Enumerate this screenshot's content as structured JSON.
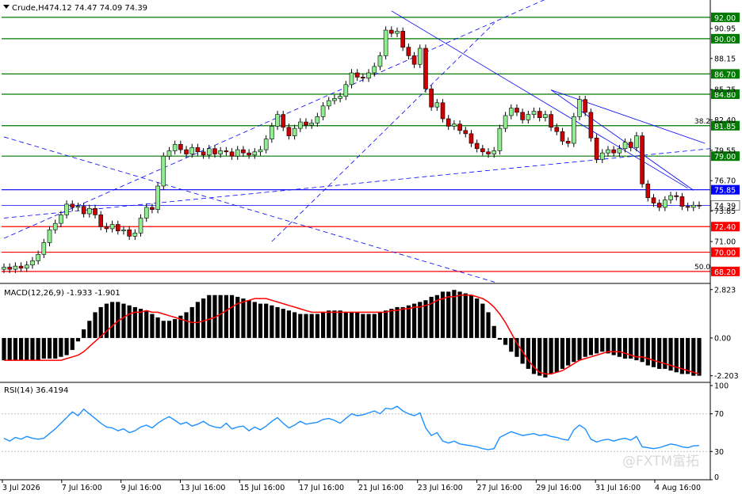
{
  "header": {
    "symbol": "Crude,H4",
    "ohlc": "74.12 74.47 74.09 74.39",
    "macd": "MACD(12,26,9) -1.933 -1.901",
    "rsi": "RSI(14) 36.4194"
  },
  "watermark": "@FXTM富拓",
  "colors": {
    "green_level": "#007a00",
    "red_level": "#ff0000",
    "blue_level": "#0000ff",
    "bull": "#90ee90",
    "bear": "#cc0000",
    "macd_signal": "#ff0000",
    "rsi": "#1e90ff",
    "trend": "#0000ff"
  },
  "chart_data": {
    "type": "candlestick",
    "x_tick_labels": [
      "3 Jul 2026",
      "7 Jul 16:00",
      "9 Jul 16:00",
      "13 Jul 16:00",
      "15 Jul 16:00",
      "17 Jul 16:00",
      "21 Jul 16:00",
      "23 Jul 16:00",
      "27 Jul 16:00",
      "29 Jul 16:00",
      "31 Jul 16:00",
      "4 Aug 16:00"
    ],
    "price_axis": {
      "ylim": [
        67.3,
        93.4
      ],
      "ticks": [
        "90.95",
        "88.15",
        "85.25",
        "82.40",
        "79.55",
        "76.70",
        "73.85",
        "71.00"
      ]
    },
    "levels": [
      {
        "value": 92.0,
        "label": "92.00",
        "kind": "green"
      },
      {
        "value": 90.0,
        "label": "90.00",
        "kind": "green"
      },
      {
        "value": 86.7,
        "label": "86.70",
        "kind": "green"
      },
      {
        "value": 84.8,
        "label": "84.80",
        "kind": "green"
      },
      {
        "value": 81.85,
        "label": "81.85",
        "kind": "green"
      },
      {
        "value": 79.0,
        "label": "79.00",
        "kind": "green"
      },
      {
        "value": 75.85,
        "label": "75.85",
        "kind": "blue"
      },
      {
        "value": 74.39,
        "label": "74.39",
        "kind": "current"
      },
      {
        "value": 72.4,
        "label": "72.40",
        "kind": "red"
      },
      {
        "value": 70.0,
        "label": "70.00",
        "kind": "red"
      },
      {
        "value": 68.2,
        "label": "68.20",
        "kind": "red"
      }
    ],
    "fib_labels": [
      {
        "value": 81.85,
        "text": "38.2"
      },
      {
        "value": 68.2,
        "text": "50.0"
      }
    ],
    "close_series": [
      68.6,
      68.4,
      68.7,
      68.5,
      68.8,
      69.2,
      69.8,
      70.9,
      72.1,
      72.7,
      73.5,
      74.5,
      74.2,
      74.3,
      73.6,
      74.1,
      73.5,
      72.4,
      72.2,
      72.6,
      72.0,
      72.1,
      71.5,
      71.8,
      73.2,
      74.2,
      74.0,
      76.2,
      79.0,
      79.5,
      80.1,
      79.6,
      79.2,
      79.8,
      79.4,
      79.1,
      79.7,
      79.2,
      79.5,
      79.4,
      79.0,
      79.6,
      79.3,
      79.1,
      79.4,
      79.6,
      80.6,
      81.8,
      82.9,
      81.7,
      80.9,
      81.6,
      82.2,
      81.9,
      82.1,
      82.7,
      83.7,
      84.2,
      84.4,
      84.6,
      85.7,
      86.8,
      86.4,
      86.3,
      86.8,
      87.4,
      88.4,
      90.8,
      90.5,
      90.7,
      89.2,
      88.4,
      87.6,
      89.1,
      85.3,
      83.6,
      84.0,
      82.5,
      81.8,
      82.0,
      81.4,
      81.1,
      80.2,
      79.7,
      79.4,
      79.2,
      79.5,
      81.6,
      82.8,
      83.5,
      83.1,
      82.4,
      82.9,
      83.2,
      82.6,
      82.9,
      81.7,
      81.3,
      80.4,
      80.2,
      82.7,
      84.3,
      83.1,
      80.7,
      78.7,
      79.3,
      79.6,
      79.3,
      79.7,
      80.3,
      79.8,
      80.9,
      76.4,
      75.1,
      74.6,
      74.2,
      74.9,
      75.3,
      75.2,
      74.3,
      74.2,
      74.4,
      74.39
    ],
    "macd": {
      "ylim": [
        -2.45,
        2.95
      ],
      "ticks": [
        "2.823",
        "0.00",
        "-2.203"
      ],
      "histogram": [
        -1.3,
        -1.3,
        -1.3,
        -1.3,
        -1.3,
        -1.3,
        -1.3,
        -1.2,
        -1.2,
        -1.2,
        -1.1,
        -1.0,
        -0.7,
        -0.2,
        0.5,
        1.0,
        1.5,
        1.8,
        2.0,
        2.1,
        2.1,
        2.0,
        1.9,
        1.8,
        1.7,
        1.6,
        1.4,
        1.2,
        1.0,
        1.0,
        1.1,
        1.3,
        1.5,
        1.8,
        2.1,
        2.3,
        2.5,
        2.5,
        2.5,
        2.5,
        2.5,
        2.4,
        2.3,
        2.2,
        2.1,
        2.0,
        2.0,
        1.9,
        1.8,
        1.7,
        1.6,
        1.5,
        1.4,
        1.4,
        1.4,
        1.4,
        1.5,
        1.6,
        1.6,
        1.6,
        1.5,
        1.5,
        1.5,
        1.4,
        1.4,
        1.4,
        1.5,
        1.6,
        1.7,
        1.8,
        1.8,
        1.9,
        2.0,
        2.1,
        2.2,
        2.4,
        2.5,
        2.7,
        2.7,
        2.8,
        2.7,
        2.6,
        2.5,
        2.3,
        2.0,
        1.5,
        0.7,
        -0.1,
        -0.4,
        -0.8,
        -1.1,
        -1.5,
        -1.8,
        -2.1,
        -2.2,
        -2.3,
        -2.1,
        -2.0,
        -1.8,
        -1.6,
        -1.4,
        -1.3,
        -1.1,
        -1.0,
        -0.9,
        -0.8,
        -0.9,
        -1.0,
        -1.1,
        -1.2,
        -1.2,
        -1.3,
        -1.4,
        -1.6,
        -1.7,
        -1.8,
        -1.8,
        -1.9,
        -2.0,
        -2.1,
        -2.1,
        -2.2,
        -2.2
      ],
      "signal": [
        -1.3,
        -1.3,
        -1.3,
        -1.3,
        -1.3,
        -1.3,
        -1.3,
        -1.3,
        -1.3,
        -1.3,
        -1.3,
        -1.2,
        -1.1,
        -1.0,
        -0.8,
        -0.5,
        -0.2,
        0.1,
        0.4,
        0.7,
        1.0,
        1.2,
        1.4,
        1.5,
        1.5,
        1.6,
        1.5,
        1.5,
        1.4,
        1.3,
        1.2,
        1.1,
        1.0,
        0.9,
        0.9,
        1.0,
        1.1,
        1.2,
        1.4,
        1.6,
        1.8,
        2.0,
        2.1,
        2.2,
        2.3,
        2.3,
        2.3,
        2.2,
        2.1,
        2.0,
        1.9,
        1.8,
        1.7,
        1.6,
        1.5,
        1.5,
        1.5,
        1.5,
        1.5,
        1.5,
        1.5,
        1.5,
        1.5,
        1.5,
        1.5,
        1.5,
        1.5,
        1.5,
        1.6,
        1.6,
        1.7,
        1.7,
        1.8,
        1.8,
        1.9,
        2.0,
        2.2,
        2.3,
        2.4,
        2.4,
        2.5,
        2.5,
        2.5,
        2.4,
        2.3,
        2.1,
        1.8,
        1.4,
        0.9,
        0.3,
        -0.3,
        -0.8,
        -1.3,
        -1.7,
        -2.0,
        -2.1,
        -2.1,
        -2.0,
        -1.9,
        -1.7,
        -1.5,
        -1.3,
        -1.2,
        -1.1,
        -1.0,
        -0.9,
        -0.8,
        -0.8,
        -0.8,
        -0.9,
        -1.0,
        -1.1,
        -1.1,
        -1.2,
        -1.3,
        -1.4,
        -1.5,
        -1.6,
        -1.7,
        -1.8,
        -1.9,
        -2.0,
        -2.1
      ]
    },
    "rsi": {
      "ylim": [
        0,
        100
      ],
      "ticks": [
        "100",
        "70",
        "30",
        "0"
      ],
      "levels": [
        70,
        30
      ],
      "values": [
        44,
        41,
        45,
        43,
        46,
        44,
        43,
        44,
        49,
        54,
        60,
        66,
        72,
        68,
        75,
        70,
        65,
        60,
        56,
        55,
        52,
        54,
        50,
        52,
        56,
        58,
        55,
        60,
        64,
        67,
        63,
        59,
        61,
        57,
        59,
        62,
        58,
        56,
        55,
        60,
        54,
        56,
        57,
        52,
        56,
        53,
        57,
        62,
        66,
        60,
        55,
        58,
        62,
        59,
        60,
        61,
        64,
        65,
        63,
        60,
        65,
        70,
        68,
        69,
        71,
        73,
        70,
        76,
        75,
        78,
        73,
        70,
        68,
        71,
        55,
        47,
        50,
        41,
        39,
        41,
        38,
        37,
        36,
        35,
        33,
        32,
        33,
        45,
        48,
        51,
        49,
        47,
        48,
        49,
        47,
        48,
        46,
        45,
        43,
        42,
        53,
        58,
        54,
        43,
        40,
        42,
        43,
        41,
        43,
        44,
        42,
        46,
        35,
        34,
        33,
        34,
        36,
        38,
        37,
        35,
        34,
        36,
        36.4
      ]
    }
  }
}
